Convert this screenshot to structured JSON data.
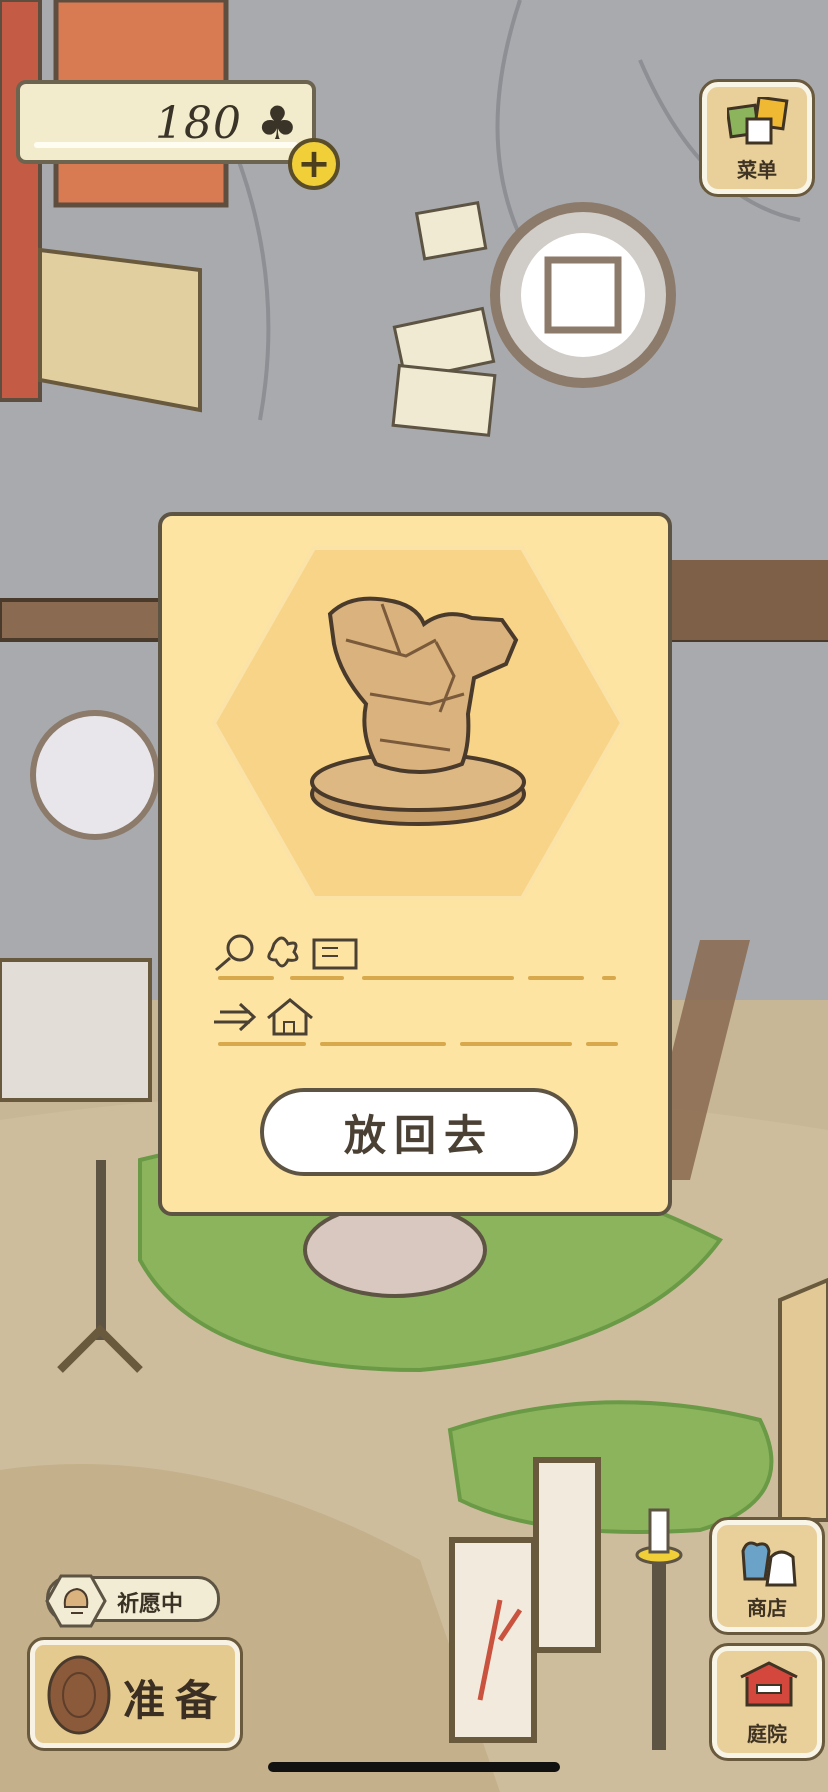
{
  "currency": {
    "clover_count": "180",
    "clover_symbol": "♣",
    "plus_label": "+"
  },
  "side_buttons": {
    "menu": "菜单",
    "shop": "商店",
    "yard": "庭院"
  },
  "dialog": {
    "item_name_icons": [
      "magnifier-icon",
      "clover-icon",
      "postcard-icon"
    ],
    "item_source_icons": [
      "arrow-icon",
      "house-icon"
    ],
    "put_back_label": "放回去"
  },
  "bottom": {
    "wish_label": "祈愿中",
    "ready_label": "准备"
  },
  "colors": {
    "dialog_bg": "#fde4a2",
    "hexagon": "#f7d487",
    "accent_line": "#d8a94c",
    "grass": "#8bb45d"
  }
}
